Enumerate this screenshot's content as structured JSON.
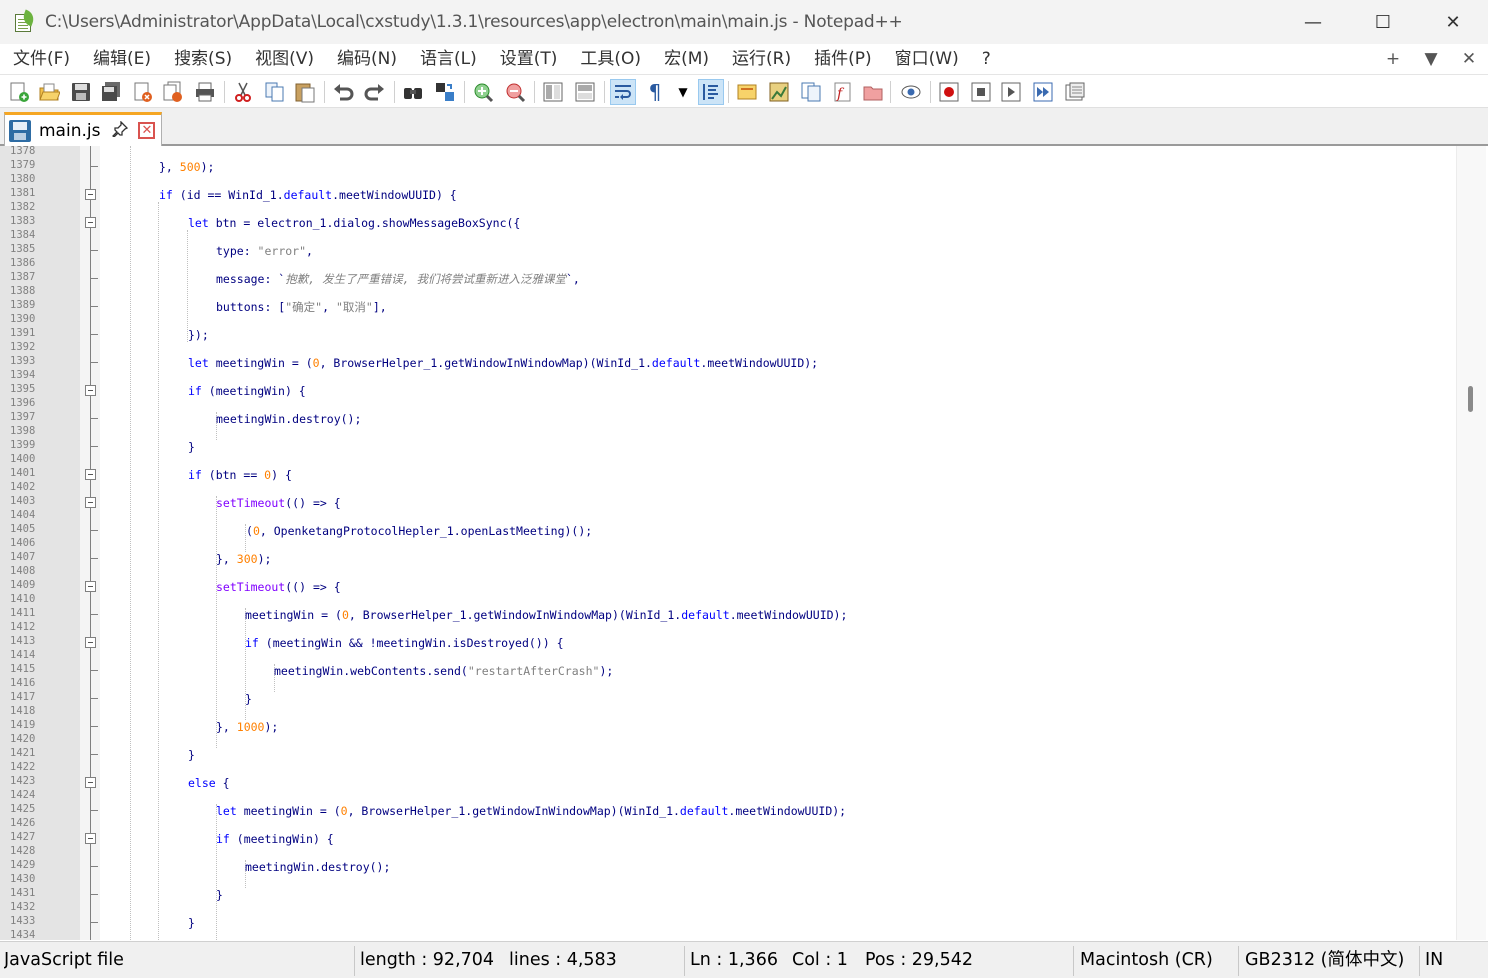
{
  "window": {
    "title": "C:\\Users\\Administrator\\AppData\\Local\\cxstudy\\1.3.1\\resources\\app\\electron\\main\\main.js - Notepad++",
    "controls": {
      "minimize": "—",
      "maximize": "☐",
      "close": "✕"
    }
  },
  "menu": {
    "items": [
      "文件(F)",
      "编辑(E)",
      "搜索(S)",
      "视图(V)",
      "编码(N)",
      "语言(L)",
      "设置(T)",
      "工具(O)",
      "宏(M)",
      "运行(R)",
      "插件(P)",
      "窗口(W)",
      "?"
    ],
    "right": {
      "add": "+",
      "dropdown": "▼",
      "close": "✕"
    }
  },
  "toolbar": {
    "icons": [
      "new-file-icon",
      "open-file-icon",
      "save-icon",
      "save-all-icon",
      "close-icon",
      "close-all-icon",
      "print-icon",
      "cut-icon",
      "copy-icon",
      "paste-icon",
      "undo-icon",
      "redo-icon",
      "find-icon",
      "replace-icon",
      "zoom-in-icon",
      "zoom-out-icon",
      "sync-vertical-icon",
      "sync-horizontal-icon",
      "word-wrap-icon",
      "show-all-chars-icon",
      "dropdown-icon",
      "indent-guide-icon",
      "user-language-icon",
      "doc-map-icon",
      "doc-list-icon",
      "function-list-icon",
      "folder-workspace-icon",
      "monitoring-icon",
      "record-macro-icon",
      "stop-record-icon",
      "play-macro-icon",
      "run-macro-multiple-icon",
      "save-macro-icon"
    ],
    "pilcrow": "¶"
  },
  "tab": {
    "label": "main.js",
    "pin": "📌",
    "close": "✕"
  },
  "editor": {
    "line_numbers": [
      "1378",
      "1379",
      "1380",
      "1381",
      "1382",
      "1383",
      "1384",
      "1385",
      "1386",
      "1387",
      "1388",
      "1389",
      "1390",
      "1391",
      "1392",
      "1393",
      "1394",
      "1395",
      "1396",
      "1397",
      "1398",
      "1399",
      "1400",
      "1401",
      "1402",
      "1403",
      "1404",
      "1405",
      "1406",
      "1407",
      "1408",
      "1409",
      "1410",
      "1411",
      "1412",
      "1413",
      "1414",
      "1415",
      "1416",
      "1417",
      "1418",
      "1419",
      "1420",
      "1421",
      "1422",
      "1423",
      "1424",
      "1425",
      "1426",
      "1427",
      "1428",
      "1429",
      "1430",
      "1431",
      "1432",
      "1433",
      "1434"
    ],
    "code": {
      "l1379": "}, 500);",
      "l1381": "if (id == WinId_1.default.meetWindowUUID) {",
      "l1383": "let btn = electron_1.dialog.showMessageBoxSync({",
      "l1385": "type: \"error\",",
      "l1387_a": "message: `",
      "l1387_b": "抱歉, 发生了严重错误, 我们将尝试重新进入泛雅课堂",
      "l1387_c": "`,",
      "l1389": "buttons: [\"确定\", \"取消\"],",
      "l1391": "});",
      "l1393": "let meetingWin = (0, BrowserHelper_1.getWindowInWindowMap)(WinId_1.default.meetWindowUUID);",
      "l1395": "if (meetingWin) {",
      "l1397": "meetingWin.destroy();",
      "l1399": "}",
      "l1401": "if (btn == 0) {",
      "l1403": "setTimeout(() => {",
      "l1405": "(0, OpenketangProtocolHepler_1.openLastMeeting)();",
      "l1407": "}, 300);",
      "l1409": "setTimeout(() => {",
      "l1411": "meetingWin = (0, BrowserHelper_1.getWindowInWindowMap)(WinId_1.default.meetWindowUUID);",
      "l1413": "if (meetingWin && !meetingWin.isDestroyed()) {",
      "l1415": "meetingWin.webContents.send(\"restartAfterCrash\");",
      "l1417": "}",
      "l1419": "}, 1000);",
      "l1421": "}",
      "l1423": "else {",
      "l1425": "let meetingWin = (0, BrowserHelper_1.getWindowInWindowMap)(WinId_1.default.meetWindowUUID);",
      "l1427": "if (meetingWin) {",
      "l1429": "meetingWin.destroy();",
      "l1431": "}",
      "l1433": "}"
    }
  },
  "status": {
    "file_type": "JavaScript file",
    "length": "length : 92,704",
    "lines": "lines : 4,583",
    "ln": "Ln : 1,366",
    "col": "Col : 1",
    "pos": "Pos : 29,542",
    "eol": "Macintosh (CR)",
    "encoding": "GB2312 (简体中文)",
    "ins": "IN"
  },
  "colors": {
    "keyword": "#0000ff",
    "number": "#ff8000",
    "string": "#808080",
    "function": "#8000ff",
    "default": "#000080",
    "tab_accent": "#f5a623"
  }
}
